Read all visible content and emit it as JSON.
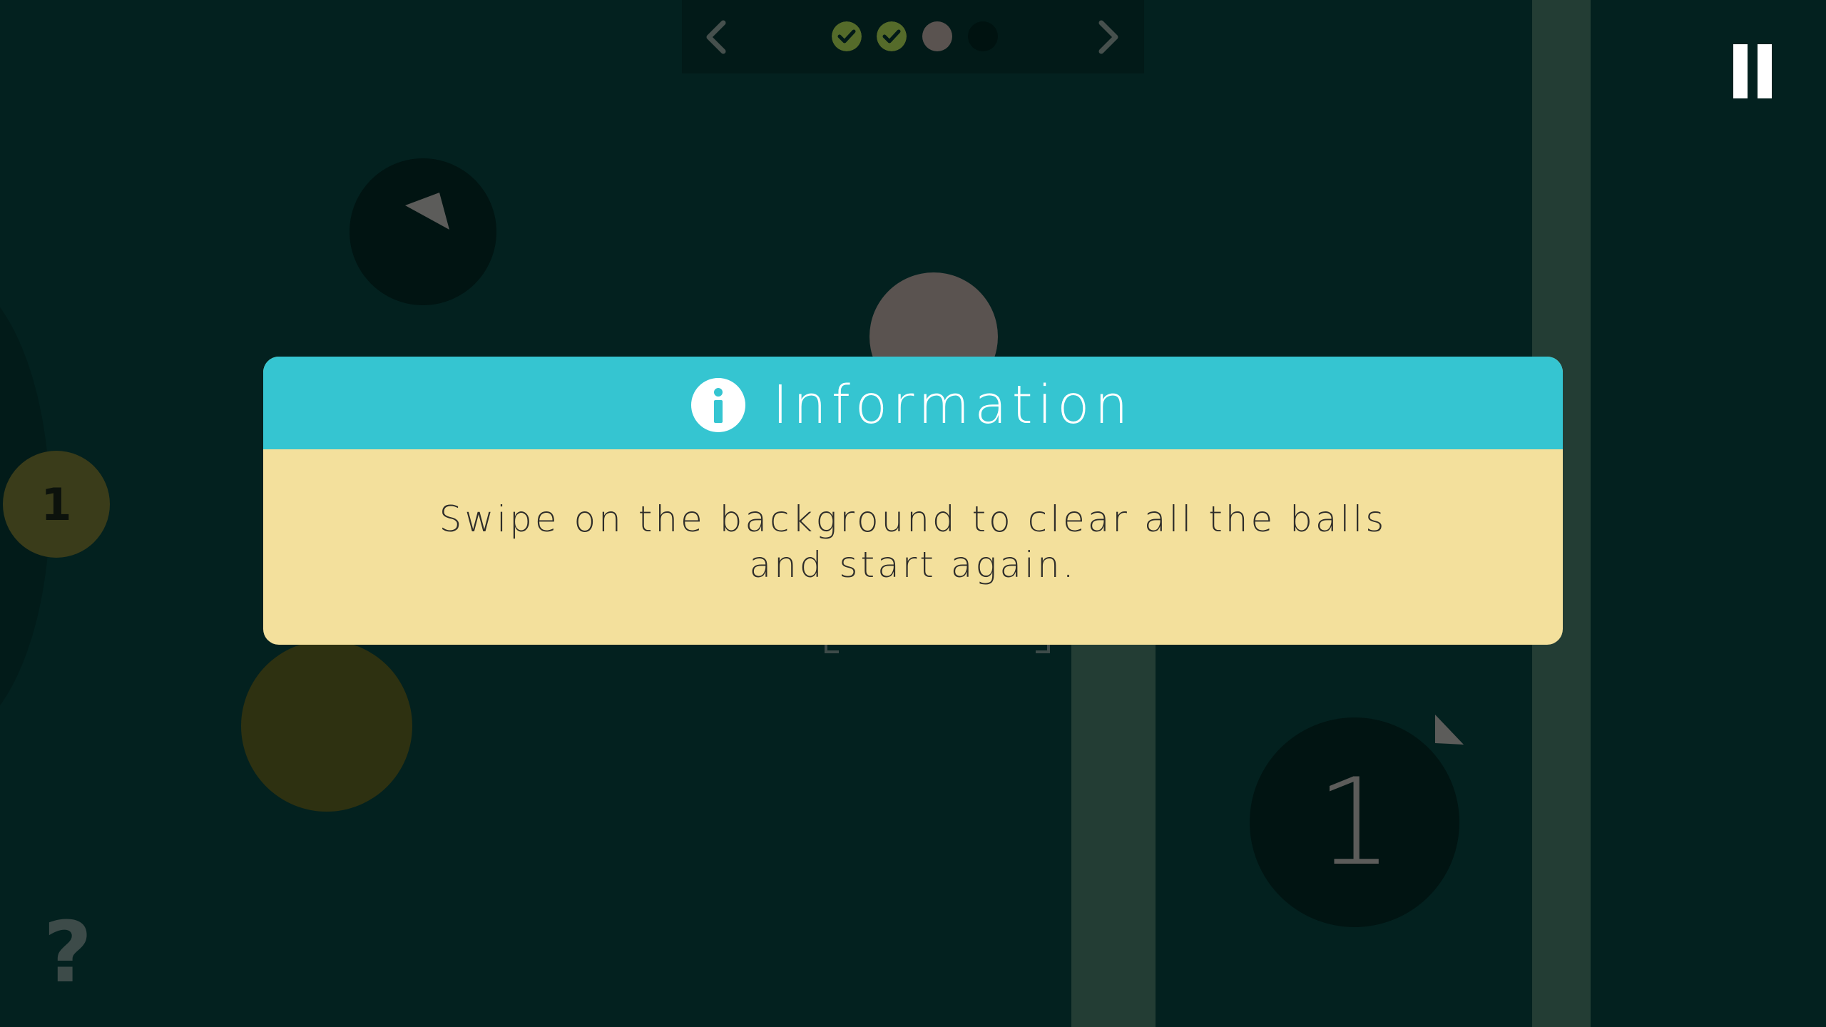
{
  "level_progress": {
    "levels": [
      {
        "state": "completed",
        "icon": "check-icon"
      },
      {
        "state": "completed",
        "icon": "check-icon"
      },
      {
        "state": "current",
        "icon": "dot"
      },
      {
        "state": "locked",
        "icon": "dot"
      }
    ],
    "prev_icon": "chevron-left-icon",
    "next_icon": "chevron-right-icon"
  },
  "game": {
    "balls": [
      {
        "label": "1"
      },
      {
        "label": "1"
      }
    ]
  },
  "help": {
    "label": "?"
  },
  "pause_icon": "pause-icon",
  "dialog": {
    "title": "Information",
    "message": "Swipe on the background to clear all the balls and start again.",
    "icon": "info-icon"
  },
  "colors": {
    "background": "#03211f",
    "dialog_header": "#35c5d1",
    "dialog_body": "#f3e09c",
    "completed_dot": "#556b2a",
    "current_dot": "#5a5350",
    "olive_ball": "#2e3111",
    "wall": "#233d34"
  }
}
